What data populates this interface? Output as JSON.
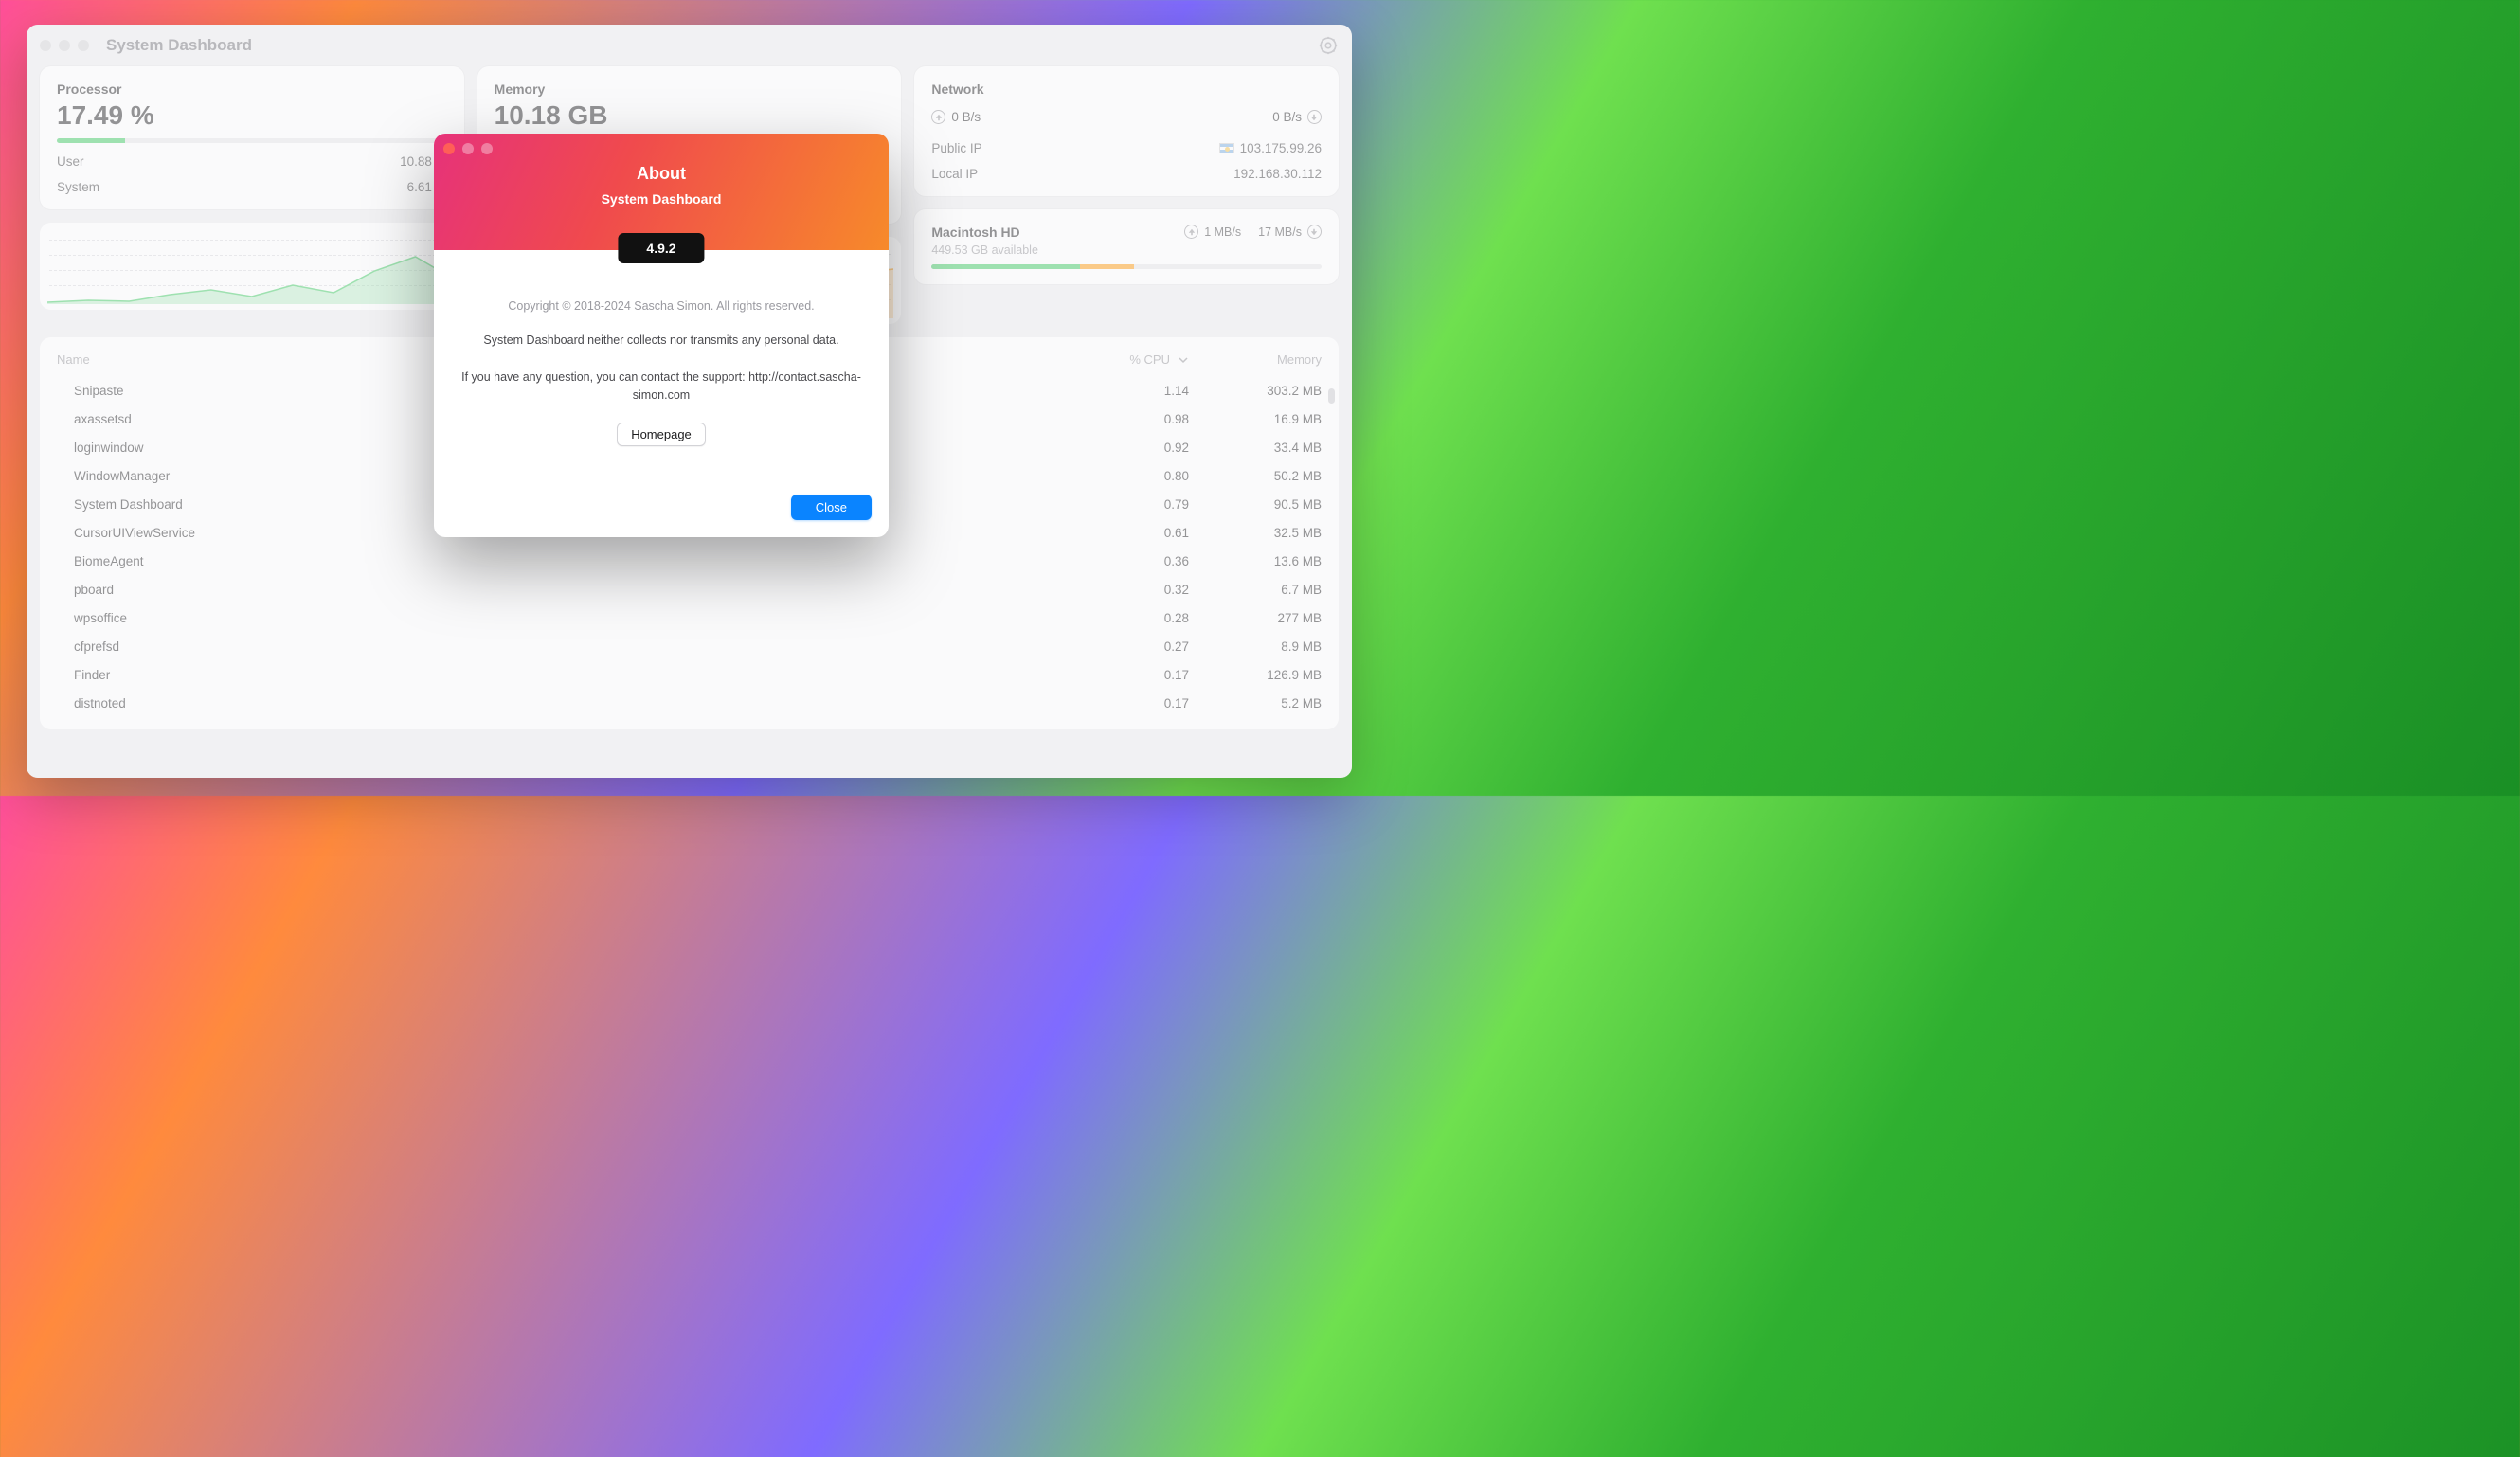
{
  "window": {
    "title": "System Dashboard"
  },
  "processor": {
    "title": "Processor",
    "value": "17.49 %",
    "user_label": "User",
    "user_value": "10.88 %",
    "system_label": "System",
    "system_value": "6.61 %",
    "bar_percent": 17.49
  },
  "memory": {
    "title": "Memory",
    "value": "10.18 GB"
  },
  "network": {
    "title": "Network",
    "up_value": "0 B/s",
    "down_value": "0 B/s",
    "public_ip_label": "Public IP",
    "public_ip_value": "103.175.99.26",
    "local_ip_label": "Local IP",
    "local_ip_value": "192.168.30.112"
  },
  "disk": {
    "title": "Macintosh HD",
    "subtitle": "449.53 GB available",
    "read_value": "1 MB/s",
    "write_value": "17 MB/s",
    "used_green_pct": 38,
    "used_orange_pct": 14
  },
  "proc_table": {
    "col_name": "Name",
    "col_cpu": "% CPU",
    "col_mem": "Memory",
    "rows": [
      {
        "name": "Snipaste",
        "cpu": "1.14",
        "mem": "303.2 MB"
      },
      {
        "name": "axassetsd",
        "cpu": "0.98",
        "mem": "16.9 MB"
      },
      {
        "name": "loginwindow",
        "cpu": "0.92",
        "mem": "33.4 MB"
      },
      {
        "name": "WindowManager",
        "cpu": "0.80",
        "mem": "50.2 MB"
      },
      {
        "name": "System Dashboard",
        "cpu": "0.79",
        "mem": "90.5 MB"
      },
      {
        "name": "CursorUIViewService",
        "cpu": "0.61",
        "mem": "32.5 MB"
      },
      {
        "name": "BiomeAgent",
        "cpu": "0.36",
        "mem": "13.6 MB"
      },
      {
        "name": "pboard",
        "cpu": "0.32",
        "mem": "6.7 MB"
      },
      {
        "name": "wpsoffice",
        "cpu": "0.28",
        "mem": "277 MB"
      },
      {
        "name": "cfprefsd",
        "cpu": "0.27",
        "mem": "8.9 MB"
      },
      {
        "name": "Finder",
        "cpu": "0.17",
        "mem": "126.9 MB"
      },
      {
        "name": "distnoted",
        "cpu": "0.17",
        "mem": "5.2 MB"
      }
    ]
  },
  "about": {
    "title": "About",
    "subtitle": "System Dashboard",
    "version": "4.9.2",
    "copyright": "Copyright © 2018-2024 Sascha Simon. All rights reserved.",
    "privacy": "System Dashboard neither collects nor transmits any personal data.",
    "support": "If you have any question, you can contact the support: http://contact.sascha-simon.com",
    "homepage_label": "Homepage",
    "close_label": "Close"
  }
}
